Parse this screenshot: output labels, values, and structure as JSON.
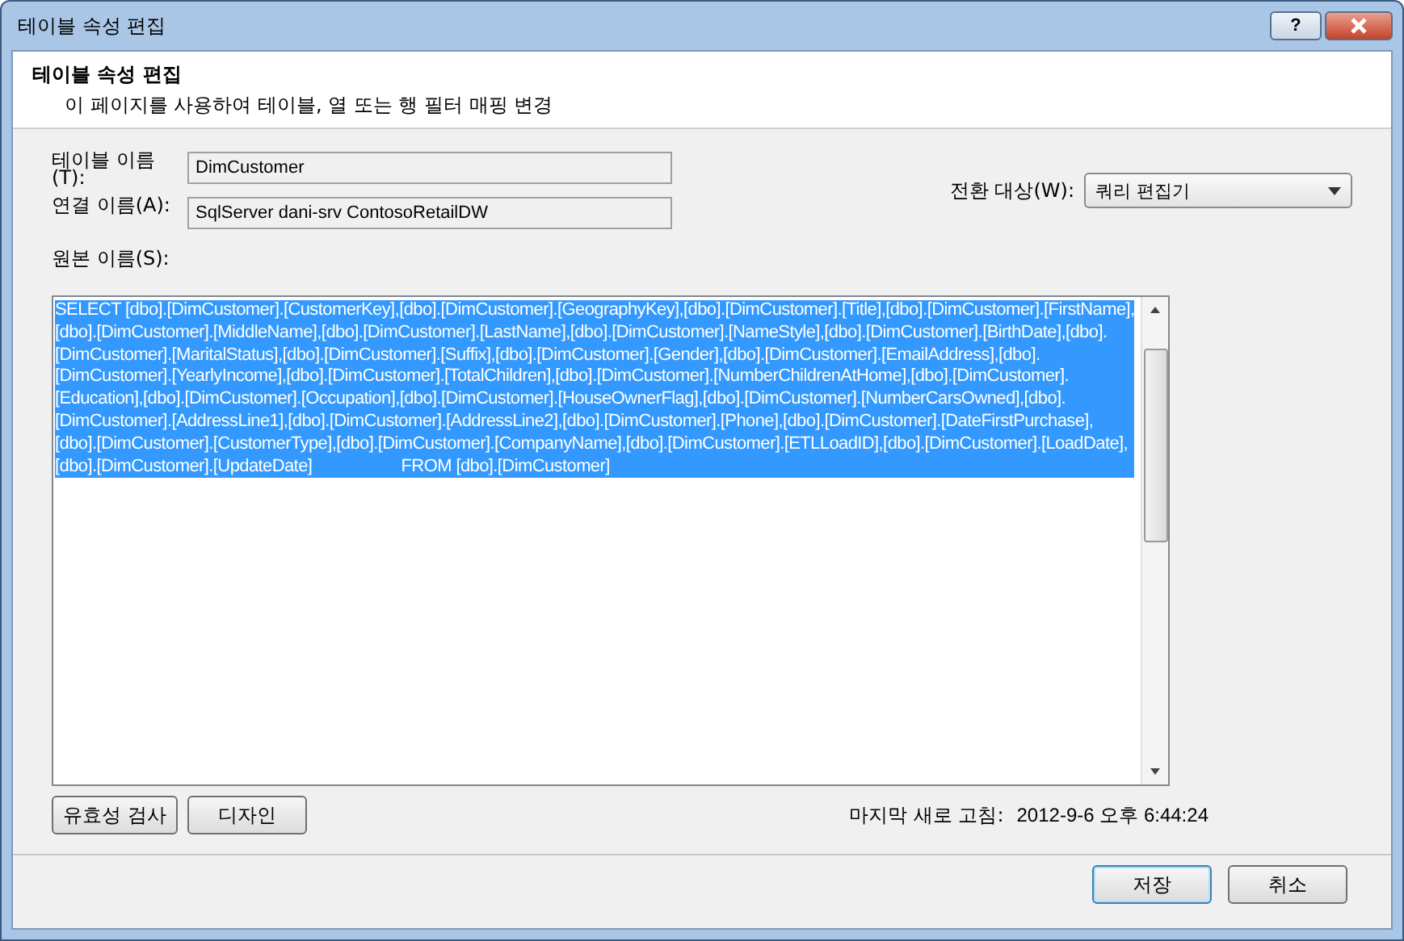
{
  "window": {
    "title": "테이블 속성 편집",
    "help": "?"
  },
  "header": {
    "title": "테이블 속성 편집",
    "subtitle": "이 페이지를 사용하여 테이블, 열 또는 행 필터 매핑 변경"
  },
  "fields": [
    {
      "label": "테이블 이름\n(T):",
      "value": "DimCustomer"
    },
    {
      "label": "연결 이름(A):",
      "value": "SqlServer dani-srv ContosoRetailDW"
    }
  ],
  "switch_to": {
    "label": "전환 대상(W):",
    "value": "쿼리 편집기"
  },
  "source_label": "원본 이름(S):",
  "query": {
    "selected": true,
    "text": "SELECT [dbo].[DimCustomer].[CustomerKey],[dbo].[DimCustomer].[GeographyKey],[dbo].[DimCustomer].[Title],[dbo].[DimCustomer].[FirstName],\n[dbo].[DimCustomer].[MiddleName],[dbo].[DimCustomer].[LastName],[dbo].[DimCustomer].[NameStyle],[dbo].[DimCustomer].[BirthDate],[dbo].\n[DimCustomer].[MaritalStatus],[dbo].[DimCustomer].[Suffix],[dbo].[DimCustomer].[Gender],[dbo].[DimCustomer].[EmailAddress],[dbo].\n[DimCustomer].[YearlyIncome],[dbo].[DimCustomer].[TotalChildren],[dbo].[DimCustomer].[NumberChildrenAtHome],[dbo].[DimCustomer].\n[Education],[dbo].[DimCustomer].[Occupation],[dbo].[DimCustomer].[HouseOwnerFlag],[dbo].[DimCustomer].[NumberCarsOwned],[dbo].\n[DimCustomer].[AddressLine1],[dbo].[DimCustomer].[AddressLine2],[dbo].[DimCustomer].[Phone],[dbo].[DimCustomer].[DateFirstPurchase],\n[dbo].[DimCustomer].[CustomerType],[dbo].[DimCustomer].[CompanyName],[dbo].[DimCustomer].[ETLLoadID],[dbo].[DimCustomer].[LoadDate],\n[dbo].[DimCustomer].[UpdateDate]                    FROM [dbo].[DimCustomer]"
  },
  "tool_buttons": [
    "유효성 검사",
    "디자인"
  ],
  "last_refresh": {
    "label": "마지막 새로 고침:",
    "value": "2012-9-6 오후 6:44:24"
  },
  "dialog_buttons": [
    {
      "label": "저장",
      "default": true
    },
    {
      "label": "취소",
      "default": false
    }
  ]
}
